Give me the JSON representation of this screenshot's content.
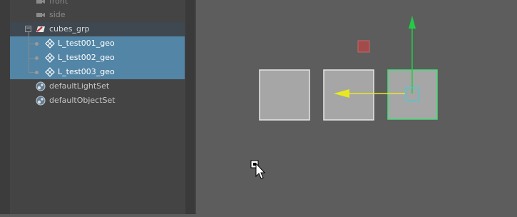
{
  "outliner": {
    "items": [
      {
        "label": "front",
        "kind": "camera"
      },
      {
        "label": "side",
        "kind": "camera"
      },
      {
        "label": "cubes_grp",
        "kind": "group"
      },
      {
        "label": "L_test001_geo",
        "kind": "mesh",
        "selected": true
      },
      {
        "label": "L_test002_geo",
        "kind": "mesh",
        "selected": true
      },
      {
        "label": "L_test003_geo",
        "kind": "mesh",
        "selected": true
      },
      {
        "label": "defaultLightSet",
        "kind": "set"
      },
      {
        "label": "defaultObjectSet",
        "kind": "set"
      }
    ],
    "expand_symbol": "−"
  },
  "viewport": {
    "objects": [
      "L_test001_geo",
      "L_test002_geo",
      "L_test003_geo"
    ],
    "manipulator": "move",
    "colors": {
      "selection_highlight": "#5285a6",
      "active_object_outline": "#44dd77",
      "y_axis": "#22cc44",
      "x_axis": "#e8e820",
      "origin_marker": "#a34a4a"
    }
  }
}
